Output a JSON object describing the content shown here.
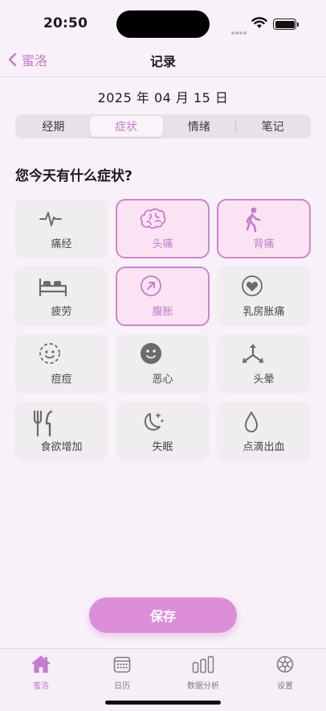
{
  "status": {
    "time": "20:50"
  },
  "nav": {
    "back_label": "蜜洛",
    "title": "记录"
  },
  "date": "2025 年 04 月 15 日",
  "tabs": [
    {
      "label": "经期",
      "active": false
    },
    {
      "label": "症状",
      "active": true
    },
    {
      "label": "情绪",
      "active": false
    },
    {
      "label": "笔记",
      "active": false
    }
  ],
  "question": "您今天有什么症状?",
  "symptoms": [
    {
      "label": "痛经",
      "icon": "pulse-icon",
      "selected": false
    },
    {
      "label": "头痛",
      "icon": "brain-icon",
      "selected": true
    },
    {
      "label": "背痛",
      "icon": "walking-person-icon",
      "selected": true
    },
    {
      "label": "疲劳",
      "icon": "bed-icon",
      "selected": false
    },
    {
      "label": "腹胀",
      "icon": "arrow-up-right-circle-icon",
      "selected": true
    },
    {
      "label": "乳房胀痛",
      "icon": "heart-circle-icon",
      "selected": false
    },
    {
      "label": "痘痘",
      "icon": "dashed-face-icon",
      "selected": false
    },
    {
      "label": "恶心",
      "icon": "smiley-face-icon",
      "selected": false
    },
    {
      "label": "头晕",
      "icon": "arrows-spread-icon",
      "selected": false
    },
    {
      "label": "食欲增加",
      "icon": "fork-knife-icon",
      "selected": false
    },
    {
      "label": "失眠",
      "icon": "moon-stars-icon",
      "selected": false
    },
    {
      "label": "点滴出血",
      "icon": "drop-icon",
      "selected": false
    }
  ],
  "save_label": "保存",
  "tabbar": [
    {
      "label": "蜜洛",
      "icon": "home-icon",
      "active": true
    },
    {
      "label": "日历",
      "icon": "calendar-icon",
      "active": false
    },
    {
      "label": "数据分析",
      "icon": "bar-chart-icon",
      "active": false
    },
    {
      "label": "设置",
      "icon": "gear-icon",
      "active": false
    }
  ],
  "colors": {
    "accent": "#c47ccc",
    "selected_bg": "#fbe3f3",
    "save_bg": "#dc8fd8",
    "background": "#f9f1f9"
  }
}
